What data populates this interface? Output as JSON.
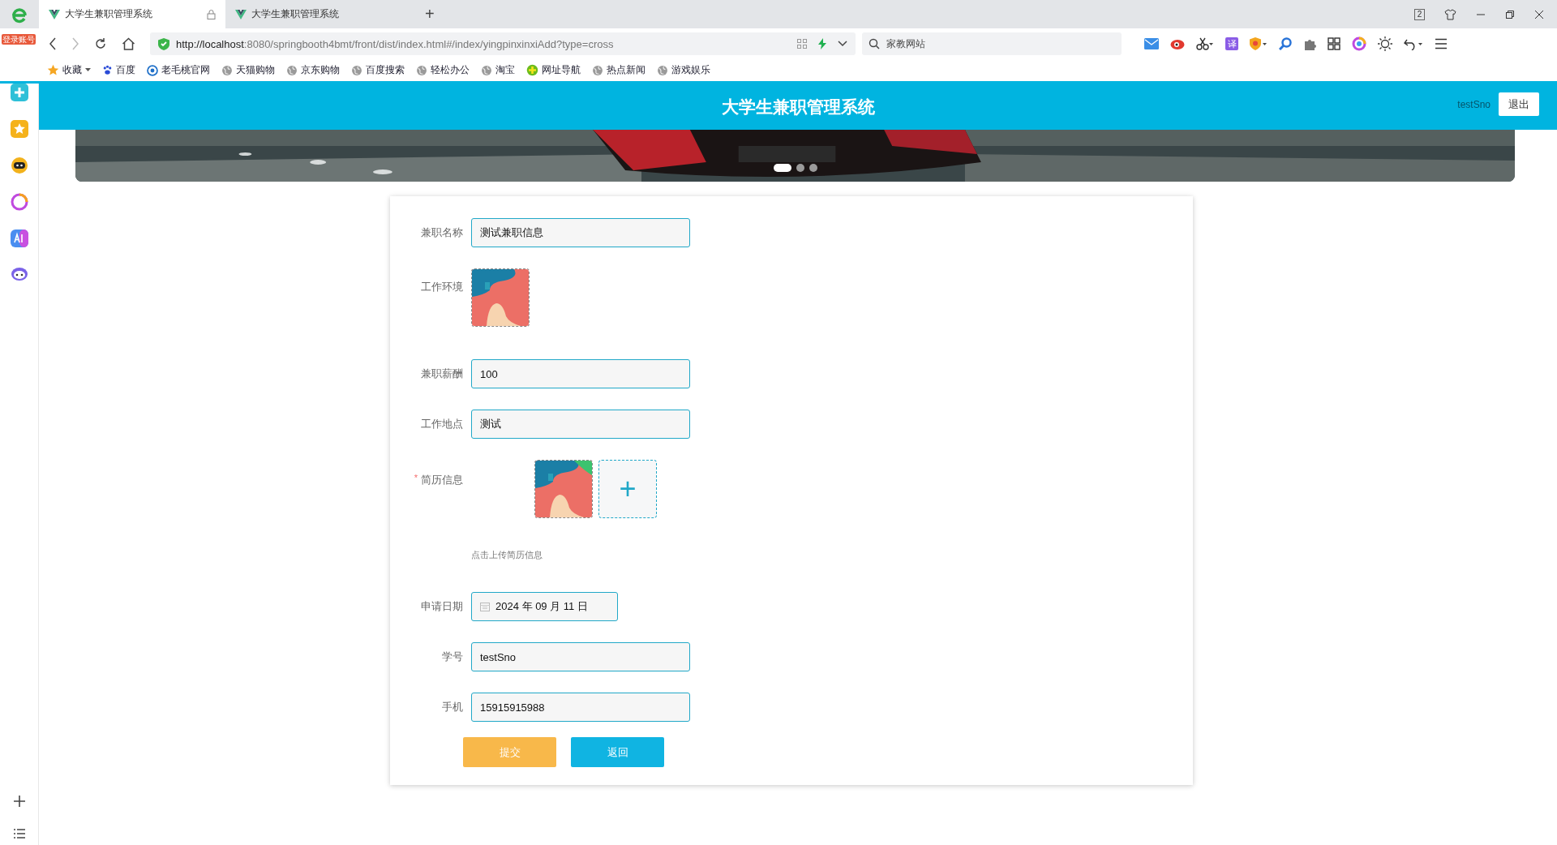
{
  "browser": {
    "badge": "登录账号",
    "tabs": [
      {
        "title": "大学生兼职管理系统",
        "selected": true
      },
      {
        "title": "大学生兼职管理系统",
        "selected": false
      }
    ],
    "new_tab": "+",
    "window_badge": "2",
    "url_host": "http://localhost",
    "url_rest": ":8080/springbooth4bmt/front/dist/index.html#/index/yingpinxinxiAdd?type=cross",
    "search_value": "家教网站",
    "translate_label": "译",
    "bookmarks": [
      {
        "kind": "star",
        "label": "收藏"
      },
      {
        "kind": "paw",
        "label": "百度"
      },
      {
        "kind": "circle",
        "label": "老毛桃官网"
      },
      {
        "kind": "globe",
        "label": "天猫购物"
      },
      {
        "kind": "globe",
        "label": "京东购物"
      },
      {
        "kind": "globe",
        "label": "百度搜索"
      },
      {
        "kind": "globe",
        "label": "轻松办公"
      },
      {
        "kind": "globe",
        "label": "淘宝"
      },
      {
        "kind": "plus",
        "label": "网址导航"
      },
      {
        "kind": "globe",
        "label": "热点新闻"
      },
      {
        "kind": "globe",
        "label": "游戏娱乐"
      }
    ]
  },
  "header": {
    "title": "大学生兼职管理系统",
    "user": "testSno",
    "logout": "退出"
  },
  "banner": {
    "kind": "picture",
    "dots": [
      {
        "selected": true
      },
      {
        "selected": false
      },
      {
        "selected": false
      }
    ]
  },
  "form": {
    "fields": [
      {
        "kind": "text",
        "label": "兼职名称",
        "value": "测试兼职信息"
      },
      {
        "label": "工作环境"
      },
      {
        "kind": "text",
        "label": "兼职薪酬",
        "value": "100"
      },
      {
        "kind": "text",
        "label": "工作地点",
        "value": "测试"
      },
      {
        "kind": "upload",
        "label": "简历信息",
        "marker": "*",
        "hint": "点击上传简历信息",
        "plus": "+"
      },
      {
        "kind": "date",
        "label": "申请日期",
        "value": "2024 年 09 月 11 日"
      },
      {
        "kind": "text",
        "label": "学号",
        "value": "testSno"
      },
      {
        "kind": "text",
        "label": "手机",
        "value": "15915915988"
      }
    ],
    "buttons": [
      {
        "kind": "submit",
        "label": "提交"
      },
      {
        "kind": "back",
        "label": "返回"
      }
    ]
  }
}
